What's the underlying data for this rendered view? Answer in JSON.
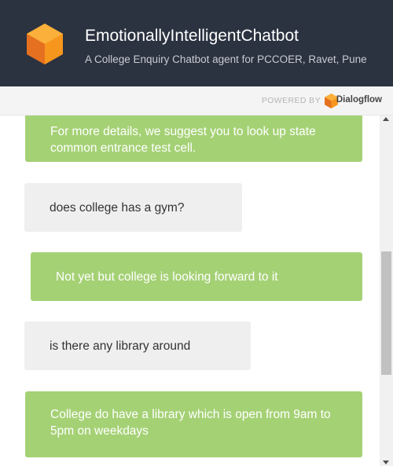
{
  "header": {
    "title": "EmotionallyIntelligentChatbot",
    "subtitle": "A College Enquiry Chatbot agent for PCCOER, Ravet, Pune",
    "logo_icon": "dialogflow-agent-icon",
    "background": "#2b3240"
  },
  "powered": {
    "label": "POWERED BY",
    "brand": "Dialogflow",
    "brand_icon": "dialogflow-logo-icon"
  },
  "colors": {
    "agent_bubble": "#a5d175",
    "user_bubble": "#efefef",
    "logo_orange": "#f7961d"
  },
  "messages": [
    {
      "sender": "agent",
      "text": "For more details, we suggest you to look up state common entrance test cell."
    },
    {
      "sender": "user",
      "text": "does college has a gym?"
    },
    {
      "sender": "agent",
      "text": "Not yet but college is looking forward to it"
    },
    {
      "sender": "user",
      "text": "is there any library around"
    },
    {
      "sender": "agent",
      "text": "College do have a library which is open from 9am to 5pm on weekdays"
    }
  ]
}
